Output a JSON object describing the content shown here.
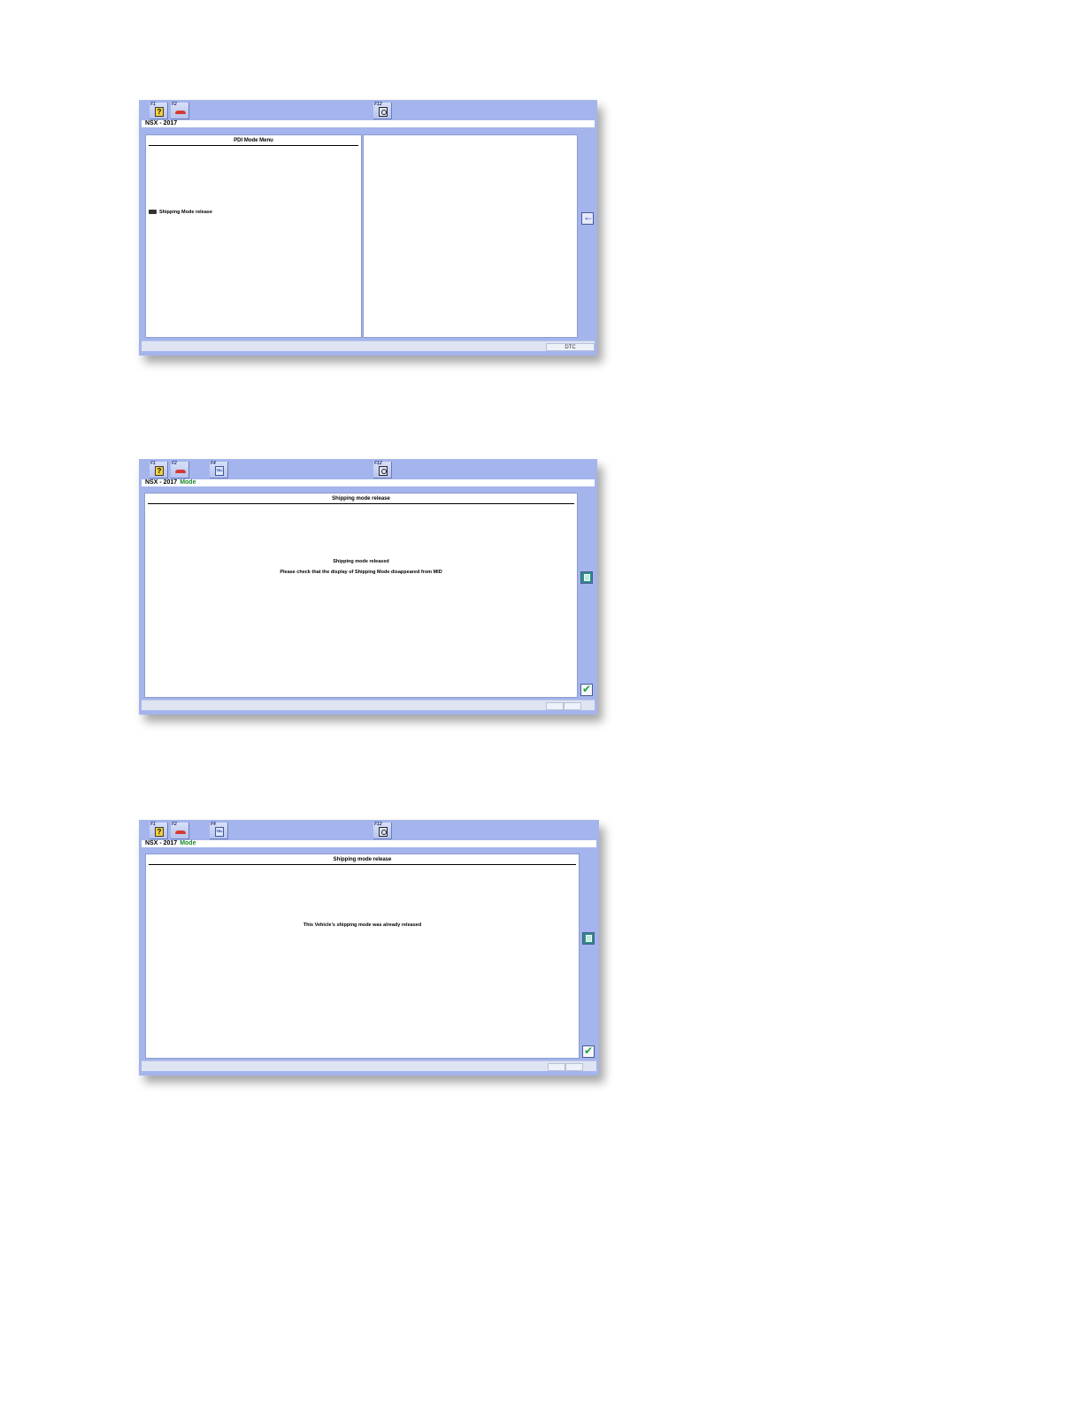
{
  "toolbar": {
    "f1_key": "F1",
    "f2_key": "F2",
    "f4_key": "F4",
    "f12_key": "F12",
    "help_glyph": "?",
    "f4_glyph": "TBL"
  },
  "screen1": {
    "vehicle": "NSX - 2017",
    "panel_title": "PDI Mode Menu",
    "menu_item": "Shipping Mode release",
    "status_label": "DTC"
  },
  "screen2": {
    "vehicle": "NSX - 2017",
    "mode_label": "Mode",
    "panel_title": "Shipping mode release",
    "message_line1": "Shipping mode released",
    "message_line2": "Please check that the display of Shipping Mode disappeared from MID"
  },
  "screen3": {
    "vehicle": "NSX - 2017",
    "mode_label": "Mode",
    "panel_title": "Shipping mode release",
    "message_line1": "This Vehicle’s shipping mode was already released"
  },
  "icons": {
    "help": "help-icon",
    "car": "car-icon",
    "monitor": "monitor-icon",
    "zoom": "zoom-icon",
    "back": "back-arrow-icon",
    "info": "info-icon",
    "ok": "checkmark-icon",
    "menu": "connector-icon"
  }
}
